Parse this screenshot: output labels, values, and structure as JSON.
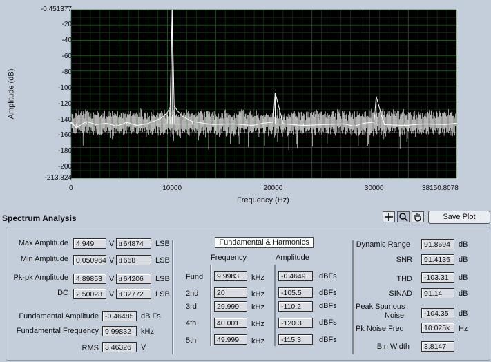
{
  "graph": {
    "y_axis_label": "Amplitude (dB)",
    "x_axis_label": "Frequency (Hz)",
    "y_ticks": [
      "-0.451377",
      "-20",
      "-40",
      "-60",
      "-80",
      "-100",
      "-120",
      "-140",
      "-160",
      "-180",
      "-200",
      "-213.824"
    ],
    "x_ticks": [
      "0",
      "10000",
      "20000",
      "30000",
      "38150.8078"
    ]
  },
  "chart_data": {
    "type": "line",
    "xlabel": "Frequency (Hz)",
    "ylabel": "Amplitude (dB)",
    "xlim": [
      0,
      38150.8078
    ],
    "ylim": [
      -213.824,
      -0.451377
    ],
    "grid": true,
    "series": [
      {
        "x": [
          0,
          500,
          1500,
          2500,
          3500,
          4500,
          5500,
          6500,
          7500,
          8500,
          9000,
          9500,
          9800,
          9998,
          10200,
          10500,
          11000,
          12000,
          14000,
          16000,
          18000,
          19000,
          20000,
          20200,
          21000,
          23000,
          25000,
          27000,
          28000,
          29000,
          30000,
          30200,
          31000,
          33000,
          35000,
          37000,
          38150
        ],
        "values": [
          -143,
          -150,
          -142,
          -146,
          -144,
          -148,
          -143,
          -147,
          -145,
          -140,
          -137,
          -131,
          -124,
          -0.46,
          -122,
          -128,
          -135,
          -142,
          -146,
          -145,
          -147,
          -144,
          -143,
          -105.5,
          -145,
          -147,
          -146,
          -145,
          -148,
          -144,
          -143,
          -110.2,
          -146,
          -147,
          -145,
          -146,
          -144
        ]
      }
    ]
  },
  "toolbar": {
    "section_title": "Spectrum  Analysis",
    "save_plot": "Save Plot",
    "tool_icons": [
      "crosshair-icon",
      "zoom-icon",
      "pan-hand-icon"
    ]
  },
  "left": {
    "max_amplitude_label": "Max Amplitude",
    "max_amplitude": "4.949",
    "max_amplitude_lsb": "64874",
    "min_amplitude_label": "Min Amplitude",
    "min_amplitude": "0.050964",
    "min_amplitude_lsb": "668",
    "pkpk_label": "Pk-pk Amplitude",
    "pkpk": "4.89853",
    "pkpk_lsb": "64206",
    "dc_label": "DC",
    "dc": "2.50028",
    "dc_lsb": "32772",
    "unit_v": "V",
    "unit_lsb": "LSB",
    "fund_amp_label": "Fundamental Amplitude",
    "fund_amp": "-0.46485",
    "fund_amp_unit": "dB Fs",
    "fund_freq_label": "Fundamental Frequency",
    "fund_freq": "9.99832",
    "fund_freq_unit": "kHz",
    "rms_label": "RMS",
    "rms": "3.46326",
    "rms_unit": "V"
  },
  "harmonics": {
    "title": "Fundamental & Harmonics",
    "freq_header": "Frequency",
    "amp_header": "Amplitude",
    "freq_unit": "kHz",
    "amp_unit": "dBFs",
    "rows": [
      {
        "label": "Fund",
        "freq": "9.9983",
        "amp": "-0.4649"
      },
      {
        "label": "2nd",
        "freq": "20",
        "amp": "-105.5"
      },
      {
        "label": "3rd",
        "freq": "29.999",
        "amp": "-110.2"
      },
      {
        "label": "4th",
        "freq": "40.001",
        "amp": "-120.3"
      },
      {
        "label": "5th",
        "freq": "49.999",
        "amp": "-115.3"
      }
    ]
  },
  "right": {
    "dynamic_range_label": "Dynamic Range",
    "dynamic_range": "91.8694",
    "snr_label": "SNR",
    "snr": "91.4136",
    "thd_label": "THD",
    "thd": "-103.31",
    "sinad_label": "SINAD",
    "sinad": "91.14",
    "peak_spur_label": "Peak Spurious\nNoise",
    "peak_spur_label_1": "Peak Spurious",
    "peak_spur_label_2": "Noise",
    "peak_spur": "-104.35",
    "pk_noise_freq_label": "Pk Noise Freq",
    "pk_noise_freq": "10.025k",
    "pk_noise_freq_unit": "Hz",
    "bin_width_label": "Bin Width",
    "bin_width": "3.8147",
    "unit_db": "dB"
  }
}
